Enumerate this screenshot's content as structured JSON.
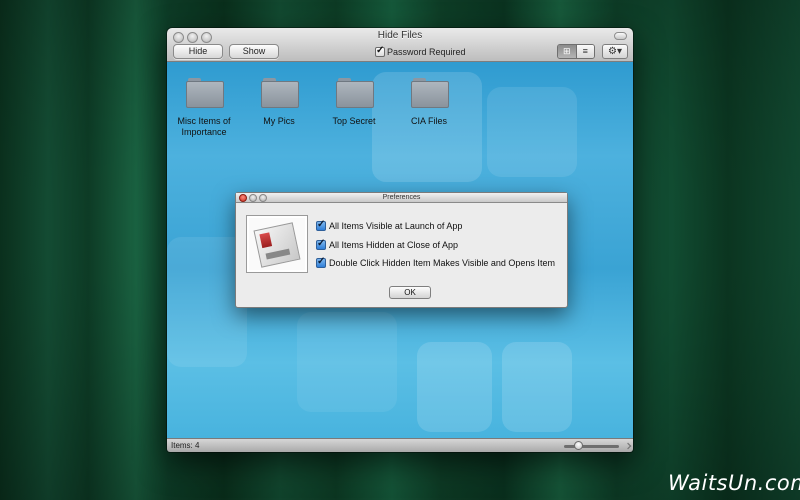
{
  "window": {
    "title": "Hide Files",
    "toolbar": {
      "hide_label": "Hide",
      "show_label": "Show",
      "password_required_label": "Password Required",
      "password_required_checked": true,
      "view_grid_icon": "grid-view-icon",
      "view_list_icon": "list-view-icon",
      "gear_icon": "gear-icon"
    },
    "folders": [
      {
        "label": "Misc Items of Importance"
      },
      {
        "label": "My Pics"
      },
      {
        "label": "Top Secret"
      },
      {
        "label": "CIA Files"
      }
    ],
    "status": {
      "items_label": "Items: 4"
    }
  },
  "preferences": {
    "title": "Preferences",
    "options": [
      {
        "label": "All Items Visible at Launch of App",
        "checked": true
      },
      {
        "label": "All Items Hidden at Close of App",
        "checked": true
      },
      {
        "label": "Double Click Hidden Item Makes Visible and Opens Item",
        "checked": true
      }
    ],
    "ok_label": "OK"
  },
  "watermark": "WaitsUn.com",
  "colors": {
    "desktop_green": "#0f452c",
    "content_blue": "#3aa3d4",
    "checkbox_blue": "#2f7ed8"
  }
}
